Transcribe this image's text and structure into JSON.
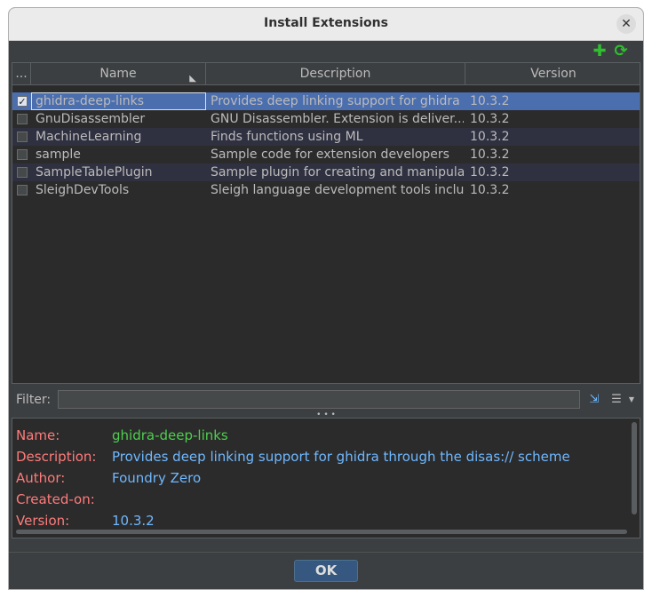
{
  "window": {
    "title": "Install Extensions",
    "close_glyph": "✕"
  },
  "toolbar": {
    "add_icon": "plus-icon",
    "refresh_icon": "refresh-icon",
    "add_glyph": "✚",
    "refresh_glyph": "⟳"
  },
  "table": {
    "columns": [
      "...",
      "Name",
      "Description",
      "Version"
    ],
    "rows": [
      {
        "checked": true,
        "name": "ghidra-deep-links",
        "description": "Provides deep linking support for ghidra t...",
        "version": "10.3.2"
      },
      {
        "checked": false,
        "name": "GnuDisassembler",
        "description": "GNU Disassembler.  Extension is deliver...",
        "version": "10.3.2"
      },
      {
        "checked": false,
        "name": "MachineLearning",
        "description": "Finds functions using ML",
        "version": "10.3.2"
      },
      {
        "checked": false,
        "name": "sample",
        "description": "Sample code for extension developers",
        "version": "10.3.2"
      },
      {
        "checked": false,
        "name": "SampleTablePlugin",
        "description": "Sample plugin for creating and manipulati...",
        "version": "10.3.2"
      },
      {
        "checked": false,
        "name": "SleighDevTools",
        "description": "Sleigh language development tools includi...",
        "version": "10.3.2"
      }
    ]
  },
  "filter": {
    "label": "Filter:",
    "value": ""
  },
  "details": {
    "name_label": "Name:",
    "name_value": "ghidra-deep-links",
    "description_label": "Description:",
    "description_value": "Provides deep linking support for ghidra through the disas:// scheme",
    "author_label": "Author:",
    "author_value": "Foundry Zero",
    "created_label": "Created-on:",
    "created_value": "",
    "version_label": "Version:",
    "version_value": "10.3.2"
  },
  "footer": {
    "ok_label": "OK"
  },
  "colors": {
    "selection": "#4b6eaf",
    "label": "#ff7b7b",
    "value": "#6fb8ff",
    "name_value": "#4fce4f",
    "add_icon": "#2fbf2f"
  }
}
